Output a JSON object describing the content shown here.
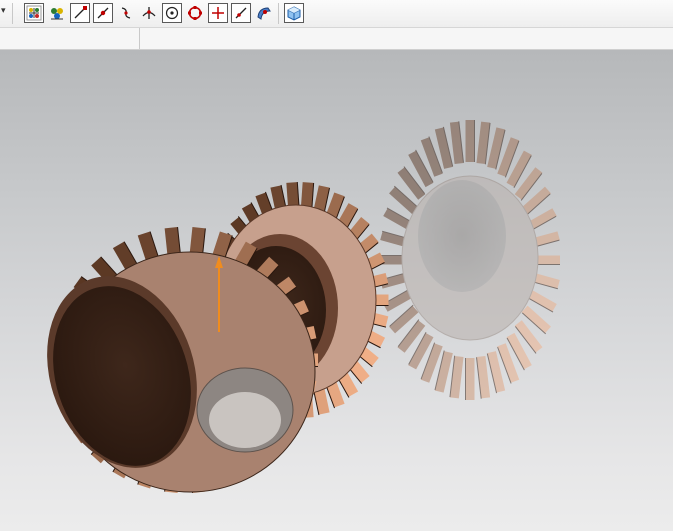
{
  "toolbar": {
    "buttons": [
      {
        "name": "toolbar-dropdown-arrow",
        "icon": "dropdown-arrow-icon"
      },
      {
        "name": "show-all-snap-points-button",
        "icon": "snap-points-icon"
      },
      {
        "name": "arrange-filter-button",
        "icon": "filter-icon"
      },
      {
        "name": "snap-end-point-button",
        "icon": "end-point-icon"
      },
      {
        "name": "snap-mid-point-button",
        "icon": "mid-point-icon"
      },
      {
        "name": "snap-control-point-button",
        "icon": "control-point-icon"
      },
      {
        "name": "snap-intersection-button",
        "icon": "intersection-icon"
      },
      {
        "name": "snap-arc-center-button",
        "icon": "arc-center-icon"
      },
      {
        "name": "snap-quadrant-button",
        "icon": "quadrant-icon"
      },
      {
        "name": "snap-existing-point-button",
        "icon": "existing-point-icon"
      },
      {
        "name": "snap-point-on-curve-button",
        "icon": "point-on-curve-icon"
      },
      {
        "name": "snap-point-on-surface-button",
        "icon": "point-on-surface-icon"
      },
      {
        "name": "view-3d-cube-button",
        "icon": "cube-view-icon"
      }
    ]
  },
  "status": {
    "left_field": "",
    "right_field": ""
  },
  "colors": {
    "accent_red": "#c00000",
    "gear_dark": "#3b2519",
    "gear_mid": "#8a5a42",
    "gear_light": "#e2b49a",
    "selection_orange": "#f08c1e"
  }
}
